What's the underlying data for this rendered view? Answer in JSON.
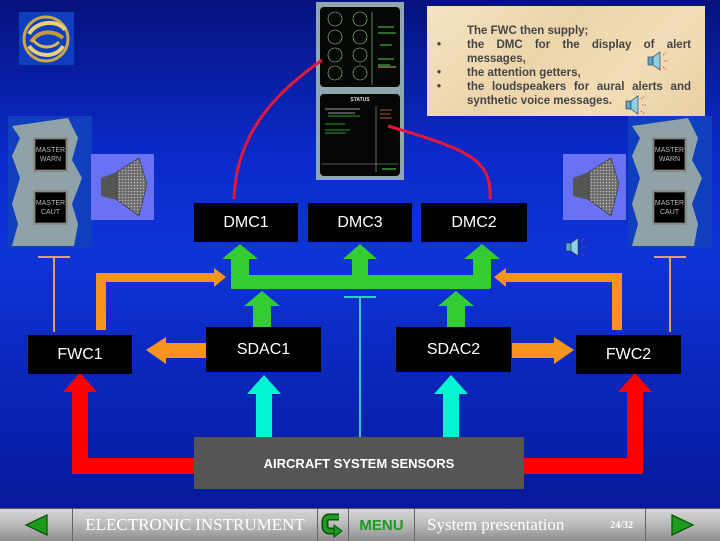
{
  "logo": {
    "icon": "airline-swirl-logo"
  },
  "note": {
    "title": "The FWC then supply;",
    "items": [
      "the DMC for the display of alert messages,",
      "the attention getters,",
      "the loudspeakers for aural alerts and synthetic voice messages."
    ]
  },
  "ecam_screens": {
    "upper": "engine/system display",
    "lower_title": "STATUS"
  },
  "attention_getters": {
    "left": {
      "warn": [
        "MASTER",
        "WARN"
      ],
      "caut": [
        "MASTER",
        "CAUT"
      ]
    },
    "right": {
      "warn": [
        "MASTER",
        "WARN"
      ],
      "caut": [
        "MASTER",
        "CAUT"
      ]
    }
  },
  "diagram": {
    "dmc1": "DMC1",
    "dmc3": "DMC3",
    "dmc2": "DMC2",
    "fwc1": "FWC1",
    "fwc2": "FWC2",
    "sdac1": "SDAC1",
    "sdac2": "SDAC2",
    "sensors": "AIRCRAFT SYSTEM SENSORS"
  },
  "colors": {
    "fwc_to_dmc": "#f7941d",
    "sdac_to_dmc": "#33cc33",
    "sensors_to_sdac": "#00f5d0",
    "sensors_to_fwc": "#ff0000",
    "dmc_to_screen": "#e0183c"
  },
  "nav": {
    "prev_icon": "triangle-left-icon",
    "section": "ELECTRONIC INSTRUMENT",
    "return_icon": "return-arrow-icon",
    "menu": "MENU",
    "subtitle": "System presentation",
    "page": "24/32",
    "next_icon": "triangle-right-icon"
  }
}
